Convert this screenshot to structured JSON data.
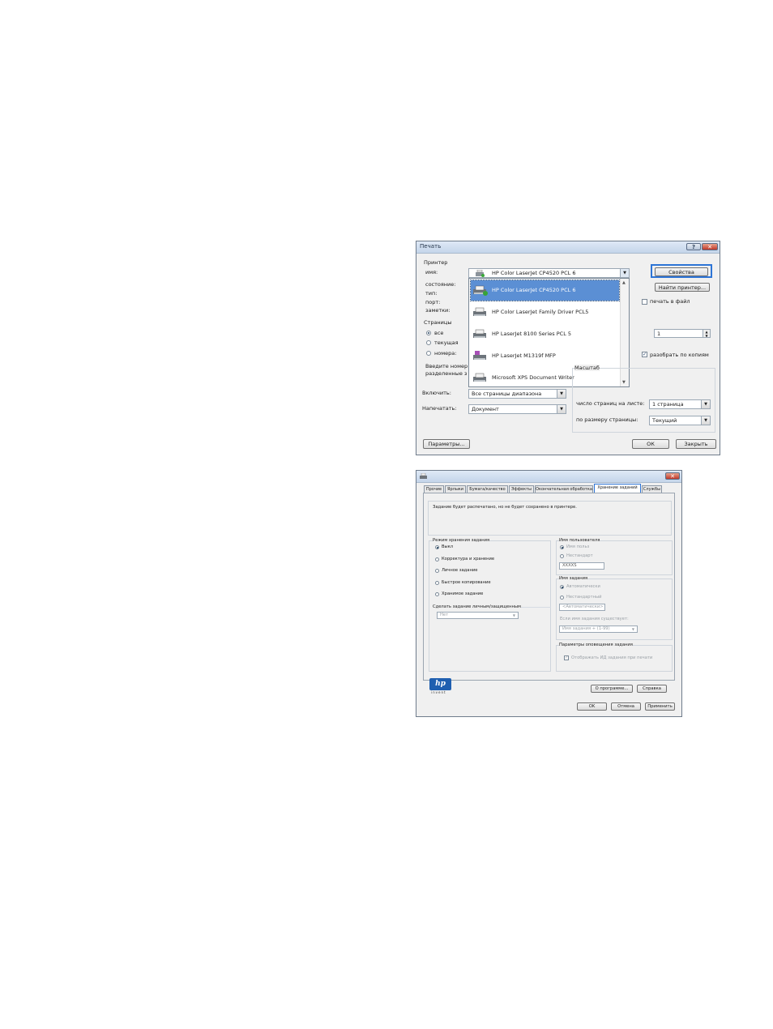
{
  "print_dialog": {
    "title": "Печать",
    "printer_group": "Принтер",
    "name_label": "имя:",
    "status_label": "состояние:",
    "type_label": "тип:",
    "port_label": "порт:",
    "notes_label": "заметки:",
    "selected_printer": "HP Color LaserJet CP4520 PCL 6",
    "printers": [
      {
        "label": "HP Color LaserJet CP4520 PCL 6",
        "selected": true
      },
      {
        "label": "HP Color LaserJet Family Driver PCL5",
        "selected": false
      },
      {
        "label": "HP LaserJet 8100 Series PCL 5",
        "selected": false
      },
      {
        "label": "HP LaserJet M1319f MFP",
        "selected": false
      },
      {
        "label": "Microsoft XPS Document Writer",
        "selected": false
      }
    ],
    "properties_button": "Свойства",
    "find_printer_button": "Найти принтер...",
    "print_to_file_label": "печать в файл",
    "pages_group": "Страницы",
    "pages_all": "все",
    "pages_current": "текущая",
    "pages_numbers": "номера:",
    "pages_hint_1": "Введите номер",
    "pages_hint_2": "разделенные з",
    "copies_value": "1",
    "collate_label": "разобрать по копиям",
    "include_label": "Включить:",
    "include_value": "Все страницы диапазона",
    "print_what_label": "Напечатать:",
    "print_what_value": "Документ",
    "scale_group": "Масштаб",
    "pages_per_sheet_label": "число страниц на листе:",
    "pages_per_sheet_value": "1 страница",
    "fit_to_label": "по размеру страницы:",
    "fit_to_value": "Текущий",
    "options_button": "Параметры...",
    "ok_button": "ОК",
    "close_button": "Закрыть"
  },
  "props_dialog": {
    "tabs": [
      {
        "label": "Прочие",
        "active": false
      },
      {
        "label": "Ярлыки",
        "active": false
      },
      {
        "label": "Бумага/качество",
        "active": false
      },
      {
        "label": "Эффекты",
        "active": false
      },
      {
        "label": "Окончательная обработка",
        "active": false
      },
      {
        "label": "Хранение заданий",
        "active": true
      },
      {
        "label": "Службы",
        "active": false
      }
    ],
    "info_text": "Задание будет распечатано, но не будет сохранено в принтере.",
    "storage_mode_group": "Режим хранения задания",
    "storage_modes": [
      "Выкл",
      "Корректура и хранение",
      "Личное задание",
      "Быстрое копирование",
      "Хранимое задание"
    ],
    "make_private_group": "Сделать задание личным/защищенным",
    "make_private_value": "Нет",
    "user_name_group": "Имя пользователя",
    "user_name_user": "Имя польз",
    "user_name_custom": "Нестандарт",
    "user_name_value": "XXXXS",
    "job_name_group": "Имя задания",
    "job_name_auto": "Автоматически",
    "job_name_custom": "Нестандартный",
    "job_name_value": "<Автоматически>",
    "if_exists_label": "Если имя задания существует:",
    "if_exists_value": "Имя задания + (1-99)",
    "notify_group": "Параметры оповещения задания",
    "notify_label": "Отображать ИД задания при печати",
    "logo_text": "invent",
    "about_button": "О программе...",
    "help_button": "Справка",
    "ok_button": "OK",
    "cancel_button": "Отмена",
    "apply_button": "Применить"
  }
}
